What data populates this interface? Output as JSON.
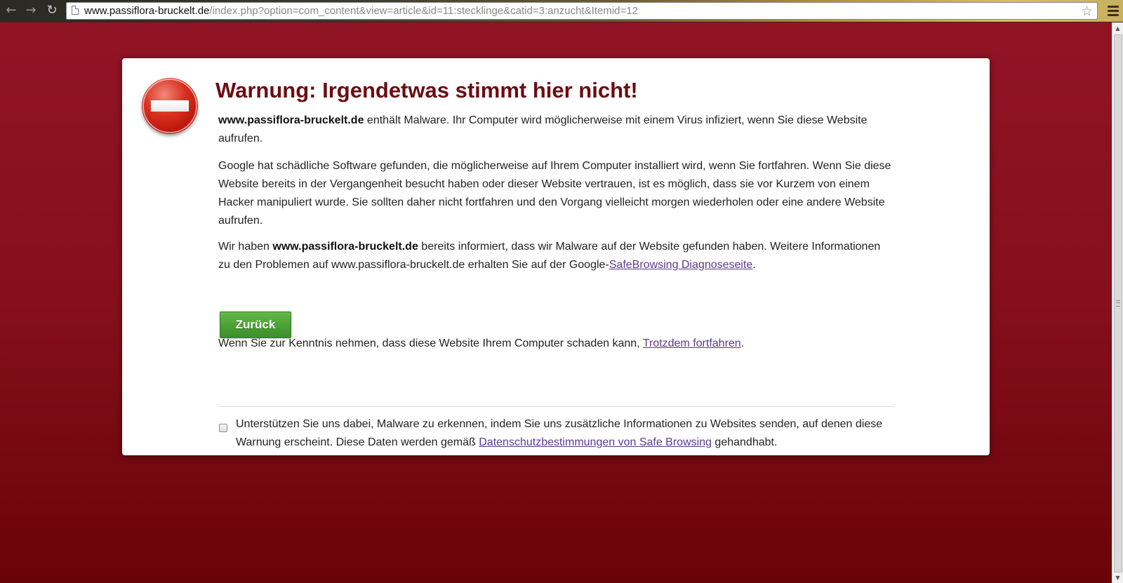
{
  "browser": {
    "url_host": "www.passiflora-bruckelt.de",
    "url_path": "/index.php?option=com_content&view=article&id=11:stecklinge&catid=3:anzucht&Itemid=12"
  },
  "warning": {
    "title": "Warnung: Irgendetwas stimmt hier nicht!",
    "p1": {
      "site": "www.passiflora-bruckelt.de",
      "text": " enthält Malware. Ihr Computer wird möglicherweise mit einem Virus infiziert, wenn Sie diese Website aufrufen."
    },
    "p2": "Google hat schädliche Software gefunden, die möglicherweise auf Ihrem Computer installiert wird, wenn Sie fortfahren. Wenn Sie diese Website bereits in der Vergangenheit besucht haben oder dieser Website vertrauen, ist es möglich, dass sie vor Kurzem von einem Hacker manipuliert wurde. Sie sollten daher nicht fortfahren und den Vorgang vielleicht morgen wiederholen oder eine andere Website aufrufen.",
    "p3": {
      "prefix": "Wir haben ",
      "site": "www.passiflora-bruckelt.de",
      "middle": " bereits informiert, dass wir Malware auf der Website gefunden haben. Weitere Informationen zu den Problemen auf www.passiflora-bruckelt.de erhalten Sie auf der Google-",
      "link": "SafeBrowsing Diagnoseseite",
      "suffix": "."
    },
    "back_button": "Zurück",
    "p4": {
      "text": "Wenn Sie zur Kenntnis nehmen, dass diese Website Ihrem Computer schaden kann, ",
      "link": "Trotzdem fortfahren",
      "suffix": "."
    },
    "report": {
      "checked": false,
      "text": "Unterstützen Sie uns dabei, Malware zu erkennen, indem Sie uns zusätzliche Informationen zu Websites senden, auf denen diese Warnung erscheint. Diese Daten werden gemäß ",
      "link": "Datenschutzbestimmungen von Safe Browsing",
      "suffix": " gehandhabt."
    }
  },
  "icons": {
    "back": "arrow-left-icon",
    "forward": "arrow-right-icon",
    "reload": "reload-icon",
    "page": "page-icon",
    "star": "star-icon",
    "menu": "menu-icon",
    "stop": "stop-icon"
  },
  "colors": {
    "background": "#850f1d",
    "title": "#6b0d12",
    "button": "#4ba036",
    "link": "#5a3b8c"
  }
}
